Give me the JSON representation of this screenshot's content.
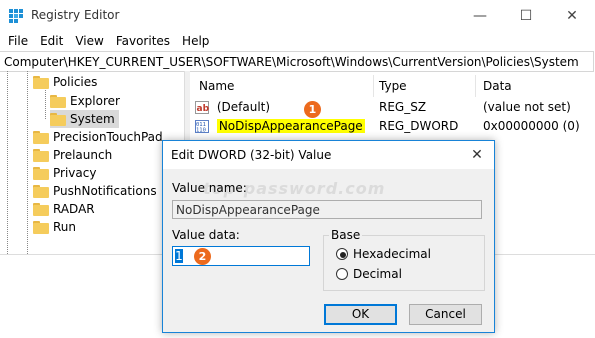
{
  "window": {
    "title": "Registry Editor",
    "controls": {
      "minimize": "—",
      "maximize": "☐",
      "close": "✕"
    }
  },
  "menu": [
    "File",
    "Edit",
    "View",
    "Favorites",
    "Help"
  ],
  "address": "Computer\\HKEY_CURRENT_USER\\SOFTWARE\\Microsoft\\Windows\\CurrentVersion\\Policies\\System",
  "tree": {
    "items": [
      {
        "label": "Policies",
        "selected": false
      },
      {
        "label": "Explorer",
        "selected": false
      },
      {
        "label": "System",
        "selected": true
      },
      {
        "label": "PrecisionTouchPad",
        "selected": false
      },
      {
        "label": "Prelaunch",
        "selected": false
      },
      {
        "label": "Privacy",
        "selected": false
      },
      {
        "label": "PushNotifications",
        "selected": false
      },
      {
        "label": "RADAR",
        "selected": false
      },
      {
        "label": "Run",
        "selected": false
      }
    ]
  },
  "list": {
    "columns": [
      "Name",
      "Type",
      "Data"
    ],
    "rows": [
      {
        "icon": "string-value-icon",
        "name": "(Default)",
        "type": "REG_SZ",
        "data": "(value not set)"
      },
      {
        "icon": "dword-value-icon",
        "name": "NoDispAppearancePage",
        "type": "REG_DWORD",
        "data": "0x00000000 (0)",
        "highlight": "#ffff00"
      }
    ]
  },
  "badges": [
    "1",
    "2"
  ],
  "watermark": "top-password.com",
  "dialog": {
    "title": "Edit DWORD (32-bit) Value",
    "close": "✕",
    "value_name_label": "Value name:",
    "value_name": "NoDispAppearancePage",
    "value_data_label": "Value data:",
    "value_data": "1",
    "base_label": "Base",
    "base_options": [
      {
        "label": "Hexadecimal",
        "checked": true
      },
      {
        "label": "Decimal",
        "checked": false
      }
    ],
    "ok_label": "OK",
    "cancel_label": "Cancel"
  }
}
